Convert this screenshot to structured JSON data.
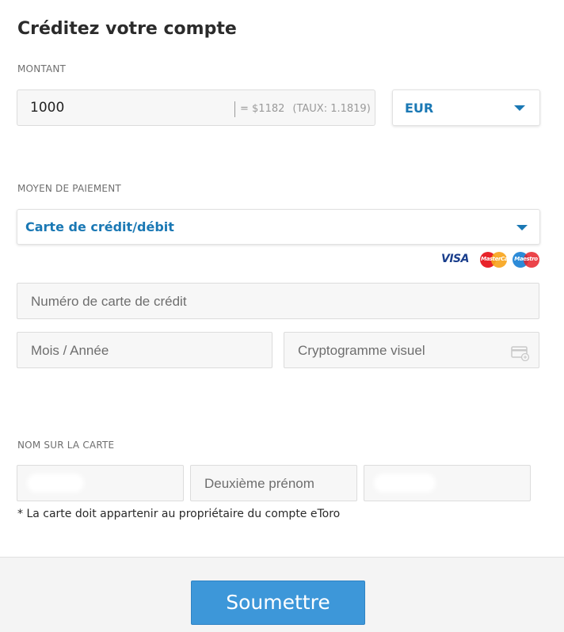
{
  "page": {
    "title": "Créditez votre compte"
  },
  "amount": {
    "label": "MONTANT",
    "value": "1000",
    "conversion": "= $1182",
    "rate": "(TAUX: 1.1819)",
    "currency": "EUR"
  },
  "payment": {
    "label": "MOYEN DE PAIEMENT",
    "method": "Carte de crédit/débit",
    "logos": {
      "visa": "VISA",
      "mastercard": "MasterCard",
      "maestro": "Maestro"
    },
    "card_number_placeholder": "Numéro de carte de crédit",
    "month_year_placeholder": "Mois / Année",
    "cvv_placeholder": "Cryptogramme visuel"
  },
  "name_on_card": {
    "label": "NOM SUR LA CARTE",
    "middle_name_placeholder": "Deuxième prénom",
    "note": "* La carte doit appartenir au propriétaire du compte eToro"
  },
  "footer": {
    "submit_label": "Soumettre"
  },
  "colors": {
    "accent": "#1a78b4",
    "button": "#3d97d9"
  },
  "icons": [
    "chevron-down-icon",
    "cvv-card-icon"
  ]
}
